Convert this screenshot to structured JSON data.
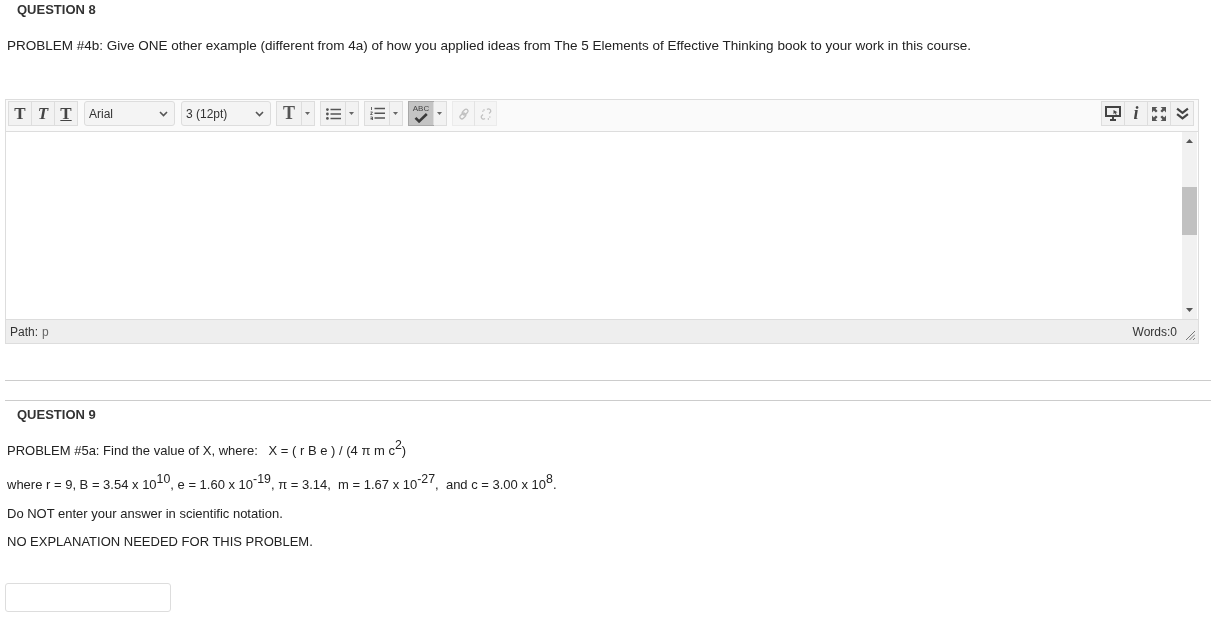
{
  "question_8": {
    "title": "QUESTION 8",
    "prompt": "PROBLEM #4b: Give ONE other example (different from 4a) of how you applied ideas from The 5 Elements of Effective Thinking book to your work in this course."
  },
  "editor": {
    "toolbar": [
      {
        "kind": "bold",
        "label": "T",
        "on": false,
        "disabled": false
      },
      {
        "kind": "italic",
        "label": "T",
        "on": false,
        "disabled": false
      },
      {
        "kind": "underline",
        "label": "T",
        "on": false,
        "disabled": false
      },
      {
        "kind": "fontname",
        "value": "Arial",
        "on": false,
        "disabled": false
      },
      {
        "kind": "fontsize",
        "value": "3 (12pt)",
        "on": false,
        "disabled": false
      },
      {
        "kind": "textcolor",
        "label": "T",
        "on": false,
        "disabled": false
      },
      {
        "kind": "bullets",
        "on": false,
        "disabled": false
      },
      {
        "kind": "numbering",
        "on": false,
        "disabled": false
      },
      {
        "kind": "spellcheck",
        "label": "ABC",
        "on": true,
        "disabled": false
      },
      {
        "kind": "link",
        "on": false,
        "disabled": true
      },
      {
        "kind": "unlink",
        "on": false,
        "disabled": true
      }
    ],
    "toolbar_right": [
      {
        "kind": "preview"
      },
      {
        "kind": "info",
        "label": "i"
      },
      {
        "kind": "fullscreen"
      },
      {
        "kind": "collapse"
      }
    ],
    "status_bar": {
      "path_label": "Path:",
      "path": "p",
      "word_count": "Words:0"
    }
  },
  "question_9": {
    "title": "QUESTION 9",
    "paragraphs": [
      "PROBLEM #5a: Find the value of X, where:   X = ( r B e ) / (4 π m c$^{2}$)",
      "where r = 9, B = 3.54 x 10$^{10}$, e = 1.60 x 10$^{-19}$, π = 3.14,  m = 1.67 x 10$^{-27}$,  and c = 3.00 x 10$^{8}$.",
      "Do NOT enter your answer in scientific notation.",
      "NO EXPLANATION NEEDED FOR THIS PROBLEM."
    ]
  }
}
